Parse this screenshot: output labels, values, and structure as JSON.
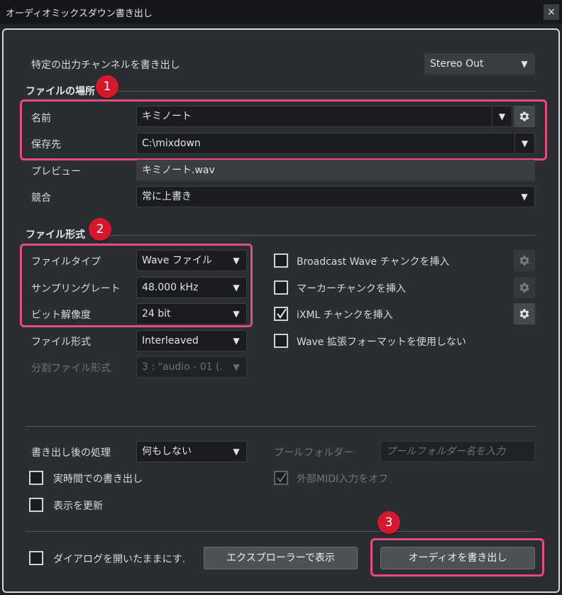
{
  "window": {
    "title": "オーディオミックスダウン書き出し",
    "close_symbol": "×"
  },
  "output_channel": {
    "label": "特定の出力チャンネルを書き出し",
    "value": "Stereo Out"
  },
  "file_location": {
    "section_title": "ファイルの場所",
    "badge": "1",
    "name_label": "名前",
    "name_value": "キミノート",
    "path_label": "保存先",
    "path_value": "C:\\mixdown",
    "preview_label": "プレビュー",
    "preview_value": "キミノート.wav",
    "conflict_label": "競合",
    "conflict_value": "常に上書き"
  },
  "file_format": {
    "section_title": "ファイル形式",
    "badge": "2",
    "type_label": "ファイルタイプ",
    "type_value": "Wave ファイル",
    "rate_label": "サンプリングレート",
    "rate_value": "48.000 kHz",
    "depth_label": "ビット解像度",
    "depth_value": "24 bit",
    "format_label": "ファイル形式",
    "format_value": "Interleaved",
    "split_label": "分割ファイル形式",
    "split_value": "3 : \"audio - 01 (."
  },
  "options": {
    "broadcast_wave": {
      "label": "Broadcast Wave チャンクを挿入",
      "checked": false
    },
    "marker_chunk": {
      "label": "マーカーチャンクを挿入",
      "checked": false
    },
    "ixml_chunk": {
      "label": "iXML チャンクを挿入",
      "checked": true
    },
    "no_wave_ext": {
      "label": "Wave 拡張フォーマットを使用しない",
      "checked": false
    }
  },
  "post_process": {
    "label": "書き出し後の処理",
    "value": "何もしない",
    "pool_folder_label": "プールフォルダー",
    "pool_folder_placeholder": "プールフォルダー名を入力",
    "realtime": {
      "label": "実時間での書き出し",
      "checked": false
    },
    "ext_midi_off": {
      "label": "外部MIDI入力をオフ",
      "checked": true
    },
    "update_display": {
      "label": "表示を更新",
      "checked": false
    }
  },
  "footer": {
    "keep_open_label": "ダイアログを開いたままにす.",
    "explorer_button": "エクスプローラーで表示",
    "export_button": "オーディオを書き出し",
    "badge": "3"
  },
  "colors": {
    "highlight": "#e34d7c",
    "badge": "#d4182e",
    "panel": "#2a2d31"
  }
}
